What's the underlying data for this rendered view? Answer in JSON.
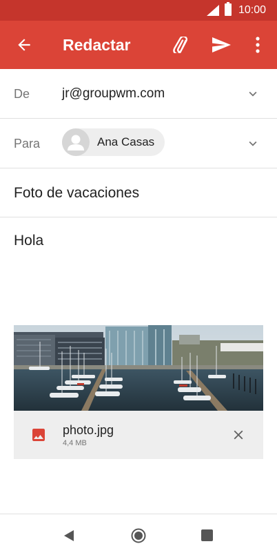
{
  "status_bar": {
    "time": "10:00",
    "icons": [
      "signal-icon",
      "battery-icon"
    ]
  },
  "app_bar": {
    "title": "Redactar",
    "color": "#db4437",
    "icons": [
      "back-arrow-icon",
      "paperclip-icon",
      "send-icon",
      "more-vert-icon"
    ]
  },
  "compose": {
    "from_label": "De",
    "from_value": "jr@groupwm.com",
    "to_label": "Para",
    "to_recipient": "Ana Casas",
    "subject": "Foto de vacaciones",
    "body": "Hola"
  },
  "attachment": {
    "filename": "photo.jpg",
    "size": "4,4 MB",
    "icons": [
      "image-icon",
      "close-icon"
    ]
  },
  "nav_bar": {
    "icons": [
      "nav-back-icon",
      "nav-home-icon",
      "nav-recents-icon"
    ]
  }
}
